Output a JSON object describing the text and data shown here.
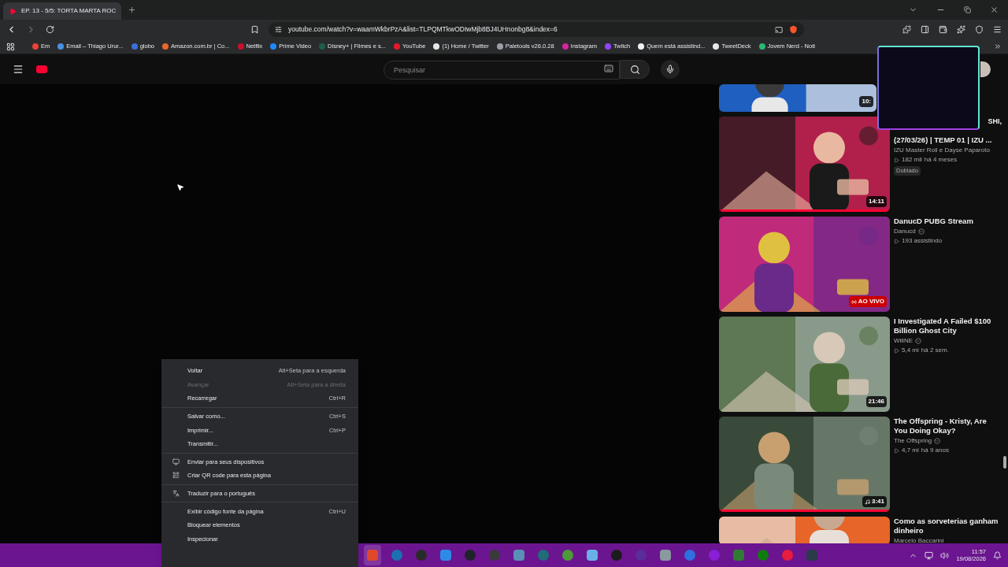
{
  "browser": {
    "tab": {
      "title": "EP. 13 - 5/5: TORTA MARTA ROC",
      "selected": true
    },
    "address": "youtube.com/watch?v=waamWkbrPzA&list=TLPQMTkwODIwMjb8BJ4UHnonbg8&index=6",
    "bookmarks": [
      {
        "label": "Em",
        "color": "#ea4335"
      },
      {
        "label": "Email – Thiago Urur...",
        "color": "#4a90e2"
      },
      {
        "label": "globo",
        "color": "#3b6fd8"
      },
      {
        "label": "Amazon.com.br | Co...",
        "color": "#e8672a"
      },
      {
        "label": "Netflix",
        "color": "#c8102e"
      },
      {
        "label": "Prime Video",
        "color": "#1a8cff"
      },
      {
        "label": "Disney+ | Filmes e s...",
        "color": "#1b5e4a"
      },
      {
        "label": "YouTube",
        "color": "#e5192b"
      },
      {
        "label": "(1) Home / Twitter",
        "color": "#e8e8e8"
      },
      {
        "label": "Paletools v26.0.28",
        "color": "#9aa0a6"
      },
      {
        "label": "Instagram",
        "color": "#d6249f"
      },
      {
        "label": "Twitch",
        "color": "#9146ff"
      },
      {
        "label": "Quem está assistind...",
        "color": "#f1f1f1"
      },
      {
        "label": "TweetDeck",
        "color": "#e8e8e8"
      },
      {
        "label": "Jovem Nerd - Noti",
        "color": "#2bb673"
      }
    ]
  },
  "youtube": {
    "search": {
      "placeholder": "Pesquisar"
    },
    "videos": [
      {
        "duration": "10:"
      },
      {
        "duration": "14:11",
        "watched": {
          "level": 1
        },
        "title_fragment": "SHI,",
        "title": "(27/03/26)  | TEMP 01 | IZU ...",
        "channel": "IZU Master Roll e Dayse Paparoto",
        "verified": false,
        "views": "182 mil",
        "age": "há 4 meses",
        "badge": "Dublado"
      },
      {
        "live": "AO VIVO",
        "title": "DanucD PUBG Stream",
        "channel": "Danucd",
        "verified": true,
        "views": "193 assistindo"
      },
      {
        "duration": "21:46",
        "title": "I Investigated A Failed $100 Billion Ghost City",
        "channel": "WillNE",
        "verified": true,
        "views": "5,4 mi",
        "age": "há 2 sem."
      },
      {
        "duration": "3:41",
        "music": true,
        "watched": {
          "level": 1
        },
        "title": "The Offspring - Kristy, Are You Doing Okay?",
        "channel": "The Offspring",
        "verified": true,
        "views": "4,7 mi",
        "age": "há 9 anos"
      },
      {
        "title": "Como as sorveterias ganham dinheiro",
        "channel": "Marcelo Baccarini",
        "verified": false
      }
    ]
  },
  "context_menu": {
    "groups": [
      [
        {
          "label": "Voltar",
          "shortcut": "Alt+Seta para a esquerda",
          "disabled": false,
          "icon": false
        },
        {
          "label": "Avançar",
          "shortcut": "Alt+Seta para a direita",
          "disabled": true,
          "icon": false
        },
        {
          "label": "Recarregar",
          "shortcut": "Ctrl+R",
          "disabled": false,
          "icon": false
        }
      ],
      [
        {
          "label": "Salvar como...",
          "shortcut": "Ctrl+S",
          "disabled": false,
          "icon": false
        },
        {
          "label": "Imprimir...",
          "shortcut": "Ctrl+P",
          "disabled": false,
          "icon": false
        },
        {
          "label": "Transmitir...",
          "disabled": false,
          "icon": false
        }
      ],
      [
        {
          "label": "Enviar para seus dispositivos",
          "disabled": false,
          "icon": true
        },
        {
          "label": "Criar QR code para esta página",
          "disabled": false,
          "icon": true
        }
      ],
      [
        {
          "label": "Traduzir para o português",
          "disabled": false,
          "icon": true
        }
      ],
      [
        {
          "label": "Exibir código fonte da página",
          "shortcut": "Ctrl+U",
          "disabled": false,
          "icon": false
        },
        {
          "label": "Bloquear elementos",
          "disabled": false,
          "icon": false
        },
        {
          "label": "Inspecionar",
          "disabled": false,
          "icon": false
        }
      ]
    ]
  },
  "taskbar": {
    "apps": [
      {
        "color": "#e0472b",
        "selected": true
      },
      {
        "color": "#1b6fb3",
        "selected": false
      },
      {
        "color": "#2a2a2a",
        "selected": false
      },
      {
        "color": "#2d8be6",
        "selected": false
      },
      {
        "color": "#20242a",
        "selected": false
      },
      {
        "color": "#3a3a3a",
        "selected": false
      },
      {
        "color": "#5a8fb8",
        "selected": false
      },
      {
        "color": "#1f6d78",
        "selected": false
      },
      {
        "color": "#4e9a3a",
        "selected": false
      },
      {
        "color": "#6ab0e8",
        "selected": false
      },
      {
        "color": "#1c1c1c",
        "selected": false
      },
      {
        "color": "#5a2d9c",
        "selected": false
      },
      {
        "color": "#8a9aa0",
        "selected": false
      },
      {
        "color": "#2f6fe0",
        "selected": false
      },
      {
        "color": "#8a1fd8",
        "selected": false
      },
      {
        "color": "#2e7d32",
        "selected": false
      },
      {
        "color": "#107c10",
        "selected": false
      },
      {
        "color": "#e81c3f",
        "selected": false
      },
      {
        "color": "#2b3b4a",
        "selected": false
      }
    ],
    "time": "11:57",
    "date": "19/08/2026"
  }
}
